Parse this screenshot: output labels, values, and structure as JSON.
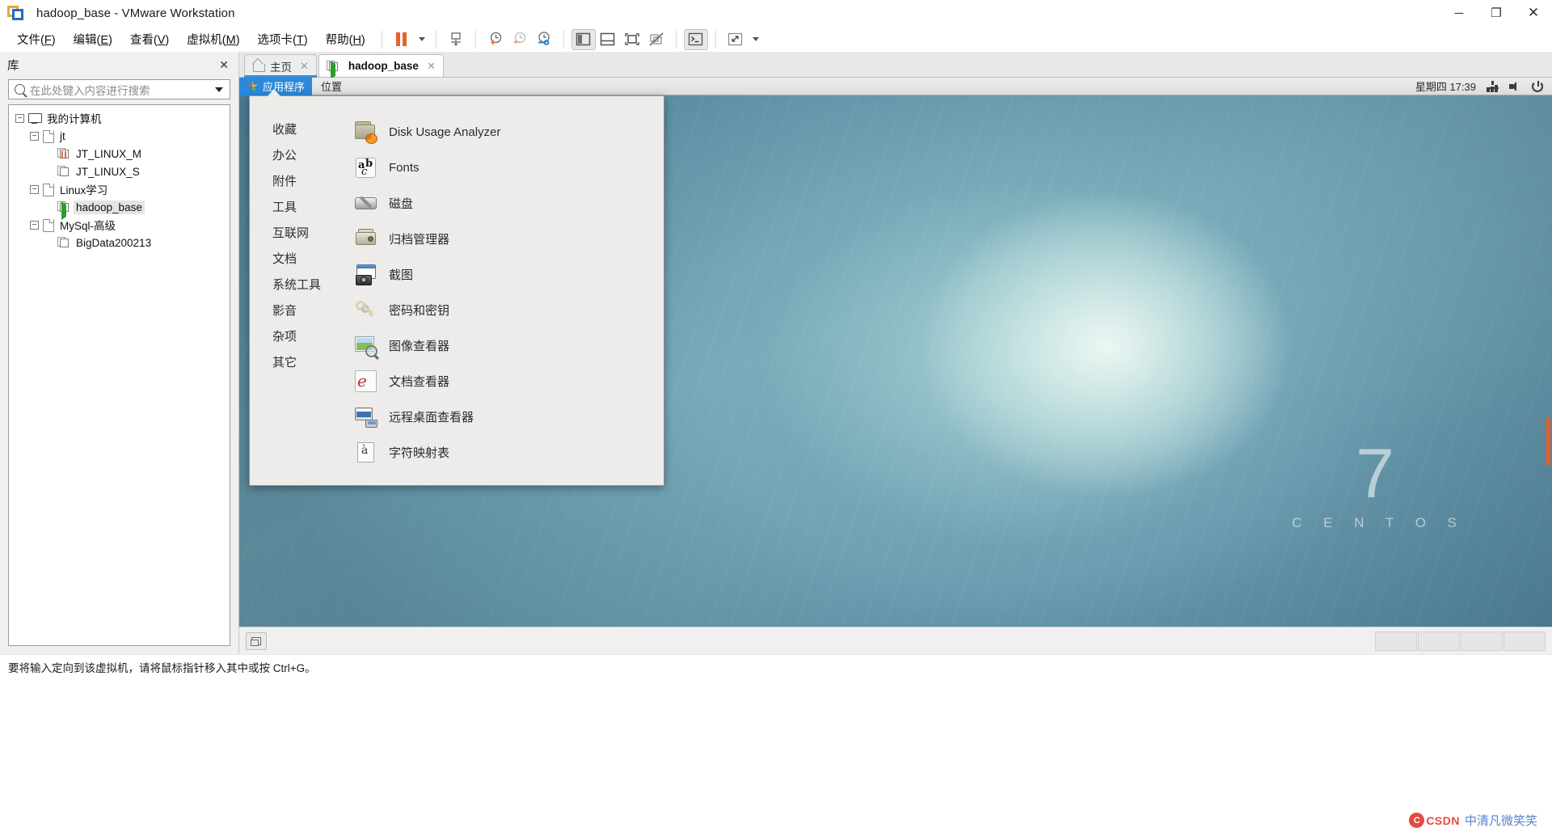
{
  "window": {
    "title": "hadoop_base - VMware Workstation",
    "app_icon": "vmware-logo-icon",
    "controls": {
      "minimize": "─",
      "maximize": "❐",
      "close": "✕"
    }
  },
  "menubar": {
    "items": [
      {
        "name": "file",
        "label": "文件(F)",
        "text": "文件(",
        "mnem": "F",
        "tail": ")"
      },
      {
        "name": "edit",
        "label": "编辑(E)",
        "text": "编辑(",
        "mnem": "E",
        "tail": ")"
      },
      {
        "name": "view",
        "label": "查看(V)",
        "text": "查看(",
        "mnem": "V",
        "tail": ")"
      },
      {
        "name": "vm",
        "label": "虚拟机(M)",
        "text": "虚拟机(",
        "mnem": "M",
        "tail": ")"
      },
      {
        "name": "tabs",
        "label": "选项卡(T)",
        "text": "选项卡(",
        "mnem": "T",
        "tail": ")"
      },
      {
        "name": "help",
        "label": "帮助(H)",
        "text": "帮助(",
        "mnem": "H",
        "tail": ")"
      }
    ]
  },
  "toolbar": {
    "buttons": [
      {
        "name": "suspend-button",
        "icon": "pause-icon"
      },
      {
        "name": "power-dropdown",
        "icon": "chevron-down-icon"
      },
      {
        "name": "manage-snapshots-button",
        "icon": "snapshot-manager-icon"
      },
      {
        "name": "take-snapshot-button",
        "icon": "clock-plus-icon"
      },
      {
        "name": "revert-snapshot-button",
        "icon": "clock-back-icon"
      },
      {
        "name": "snapshot-manager-button",
        "icon": "clock-wrench-icon"
      },
      {
        "name": "show-library-button",
        "icon": "panel-left-icon"
      },
      {
        "name": "show-thumbnail-bar-button",
        "icon": "panel-bottom-icon"
      },
      {
        "name": "full-screen-button",
        "icon": "fullscreen-icon"
      },
      {
        "name": "unity-mode-button",
        "icon": "unity-off-icon"
      },
      {
        "name": "console-button",
        "icon": "terminal-icon"
      },
      {
        "name": "stretch-button",
        "icon": "expand-arrows-icon"
      },
      {
        "name": "stretch-dropdown",
        "icon": "chevron-down-icon"
      }
    ]
  },
  "library": {
    "title": "库",
    "close_label": "✕",
    "search": {
      "placeholder": "在此处键入内容进行搜索",
      "value": "",
      "icon": "search-icon"
    },
    "tree": [
      {
        "name": "my-computer",
        "label": "我的计算机",
        "indent": 0,
        "expander": "−",
        "icon": "computer-icon"
      },
      {
        "name": "folder-jt",
        "label": "jt",
        "indent": 1,
        "expander": "−",
        "icon": "folder-icon"
      },
      {
        "name": "vm-jt-linux-m",
        "label": "JT_LINUX_M",
        "indent": 2,
        "expander": "",
        "icon": "vm-suspended-icon"
      },
      {
        "name": "vm-jt-linux-s",
        "label": "JT_LINUX_S",
        "indent": 2,
        "expander": "",
        "icon": "vm-off-icon"
      },
      {
        "name": "folder-linux-study",
        "label": "Linux学习",
        "indent": 1,
        "expander": "−",
        "icon": "folder-icon"
      },
      {
        "name": "vm-hadoop-base",
        "label": "hadoop_base",
        "indent": 2,
        "expander": "",
        "icon": "vm-running-icon",
        "selected": true
      },
      {
        "name": "folder-mysql-advanced",
        "label": "MySql-高级",
        "indent": 1,
        "expander": "−",
        "icon": "folder-icon"
      },
      {
        "name": "vm-bigdata200213",
        "label": "BigData200213",
        "indent": 2,
        "expander": "",
        "icon": "vm-off-icon"
      }
    ]
  },
  "tabs": [
    {
      "name": "tab-home",
      "label": "主页",
      "icon": "home-icon",
      "close": "✕",
      "state": "home"
    },
    {
      "name": "tab-hadoop-base",
      "label": "hadoop_base",
      "icon": "vm-running-icon",
      "close": "✕",
      "state": "selected"
    }
  ],
  "guest": {
    "panel": {
      "applications": "应用程序",
      "applications_icon": "gnome-foot-icon",
      "places": "位置",
      "clock": "星期四 17:39",
      "tray": [
        {
          "name": "network-icon",
          "icon": "network-icon"
        },
        {
          "name": "volume-icon",
          "icon": "volume-icon"
        },
        {
          "name": "power-menu-icon",
          "icon": "power-icon"
        }
      ]
    },
    "app_menu": {
      "categories": [
        {
          "name": "category-favorites",
          "label": "收藏"
        },
        {
          "name": "category-office",
          "label": "办公"
        },
        {
          "name": "category-accessories",
          "label": "附件"
        },
        {
          "name": "category-tools",
          "label": "工具"
        },
        {
          "name": "category-internet",
          "label": "互联网"
        },
        {
          "name": "category-documents",
          "label": "文档"
        },
        {
          "name": "category-system-tools",
          "label": "系统工具"
        },
        {
          "name": "category-sound-video",
          "label": "影音"
        },
        {
          "name": "category-miscellaneous",
          "label": "杂项"
        },
        {
          "name": "category-other",
          "label": "其它"
        }
      ],
      "applications": [
        {
          "name": "app-disk-usage-analyzer",
          "label": "Disk Usage Analyzer",
          "icon": "disk-usage-analyzer-icon"
        },
        {
          "name": "app-fonts",
          "label": "Fonts",
          "icon": "fonts-icon"
        },
        {
          "name": "app-disks",
          "label": "磁盘",
          "icon": "disks-icon"
        },
        {
          "name": "app-archive-manager",
          "label": "归档管理器",
          "icon": "archive-manager-icon"
        },
        {
          "name": "app-screenshot",
          "label": "截图",
          "icon": "screenshot-icon"
        },
        {
          "name": "app-passwords-and-keys",
          "label": "密码和密钥",
          "icon": "passwords-keys-icon"
        },
        {
          "name": "app-image-viewer",
          "label": "图像查看器",
          "icon": "image-viewer-icon"
        },
        {
          "name": "app-document-viewer",
          "label": "文档查看器",
          "icon": "document-viewer-icon"
        },
        {
          "name": "app-remote-desktop-viewer",
          "label": "远程桌面查看器",
          "icon": "remote-desktop-viewer-icon"
        },
        {
          "name": "app-character-map",
          "label": "字符映射表",
          "icon": "character-map-icon"
        }
      ]
    },
    "wallpaper": {
      "version": "7",
      "brand": "C E N T O S"
    }
  },
  "status_bar": {
    "message": "要将输入定向到该虚拟机，请将鼠标指针移入其中或按 Ctrl+G。"
  },
  "watermark": {
    "brand": "CSDN",
    "badge": "C",
    "nick": "中清凡微笑笑"
  }
}
